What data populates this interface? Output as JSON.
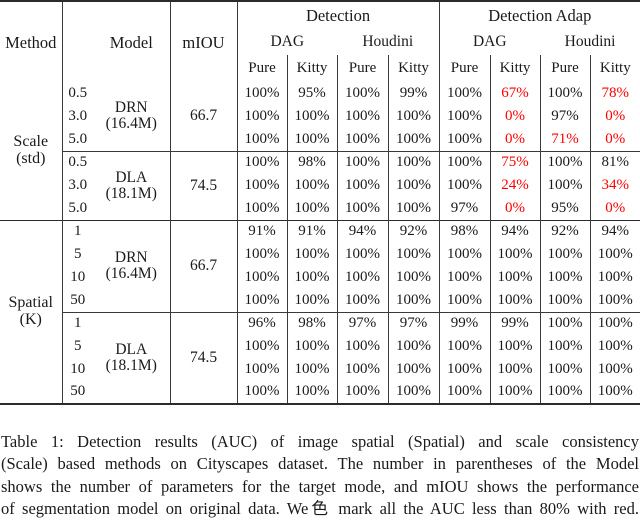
{
  "table": {
    "columns": {
      "method": "Method",
      "param": "",
      "model": "Model",
      "miou": "mIOU",
      "group_detection": "Detection",
      "group_detection_adap": "Detection Adap",
      "attack_dag_1": "DAG",
      "attack_houdini_1": "Houdini",
      "attack_dag_2": "DAG",
      "attack_houdini_2": "Houdini",
      "sub_pure": "Pure",
      "sub_kitty": "Kitty"
    },
    "sections": [
      {
        "name": "Scale",
        "name_line1": "Scale",
        "name_line2": "(std)",
        "blocks": [
          {
            "model_line1": "DRN",
            "model_line2": "(16.4M)",
            "miou": "66.7",
            "rows": [
              {
                "param": "0.5",
                "cells": [
                  {
                    "v": "100%",
                    "red": false
                  },
                  {
                    "v": "95%",
                    "red": false
                  },
                  {
                    "v": "100%",
                    "red": false
                  },
                  {
                    "v": "99%",
                    "red": false
                  },
                  {
                    "v": "100%",
                    "red": false
                  },
                  {
                    "v": "67%",
                    "red": true
                  },
                  {
                    "v": "100%",
                    "red": false
                  },
                  {
                    "v": "78%",
                    "red": true
                  }
                ]
              },
              {
                "param": "3.0",
                "cells": [
                  {
                    "v": "100%",
                    "red": false
                  },
                  {
                    "v": "100%",
                    "red": false
                  },
                  {
                    "v": "100%",
                    "red": false
                  },
                  {
                    "v": "100%",
                    "red": false
                  },
                  {
                    "v": "100%",
                    "red": false
                  },
                  {
                    "v": "0%",
                    "red": true
                  },
                  {
                    "v": "97%",
                    "red": false
                  },
                  {
                    "v": "0%",
                    "red": true
                  }
                ]
              },
              {
                "param": "5.0",
                "cells": [
                  {
                    "v": "100%",
                    "red": false
                  },
                  {
                    "v": "100%",
                    "red": false
                  },
                  {
                    "v": "100%",
                    "red": false
                  },
                  {
                    "v": "100%",
                    "red": false
                  },
                  {
                    "v": "100%",
                    "red": false
                  },
                  {
                    "v": "0%",
                    "red": true
                  },
                  {
                    "v": "71%",
                    "red": true
                  },
                  {
                    "v": "0%",
                    "red": true
                  }
                ]
              }
            ]
          },
          {
            "model_line1": "DLA",
            "model_line2": "(18.1M)",
            "miou": "74.5",
            "rows": [
              {
                "param": "0.5",
                "cells": [
                  {
                    "v": "100%",
                    "red": false
                  },
                  {
                    "v": "98%",
                    "red": false
                  },
                  {
                    "v": "100%",
                    "red": false
                  },
                  {
                    "v": "100%",
                    "red": false
                  },
                  {
                    "v": "100%",
                    "red": false
                  },
                  {
                    "v": "75%",
                    "red": true
                  },
                  {
                    "v": "100%",
                    "red": false
                  },
                  {
                    "v": "81%",
                    "red": false
                  }
                ]
              },
              {
                "param": "3.0",
                "cells": [
                  {
                    "v": "100%",
                    "red": false
                  },
                  {
                    "v": "100%",
                    "red": false
                  },
                  {
                    "v": "100%",
                    "red": false
                  },
                  {
                    "v": "100%",
                    "red": false
                  },
                  {
                    "v": "100%",
                    "red": false
                  },
                  {
                    "v": "24%",
                    "red": true
                  },
                  {
                    "v": "100%",
                    "red": false
                  },
                  {
                    "v": "34%",
                    "red": true
                  }
                ]
              },
              {
                "param": "5.0",
                "cells": [
                  {
                    "v": "100%",
                    "red": false
                  },
                  {
                    "v": "100%",
                    "red": false
                  },
                  {
                    "v": "100%",
                    "red": false
                  },
                  {
                    "v": "100%",
                    "red": false
                  },
                  {
                    "v": "97%",
                    "red": false
                  },
                  {
                    "v": "0%",
                    "red": true
                  },
                  {
                    "v": "95%",
                    "red": false
                  },
                  {
                    "v": "0%",
                    "red": true
                  }
                ]
              }
            ]
          }
        ]
      },
      {
        "name": "Spatial",
        "name_line1": "Spatial",
        "name_line2": "(K)",
        "blocks": [
          {
            "model_line1": "DRN",
            "model_line2": "(16.4M)",
            "miou": "66.7",
            "rows": [
              {
                "param": "1",
                "cells": [
                  {
                    "v": "91%",
                    "red": false
                  },
                  {
                    "v": "91%",
                    "red": false
                  },
                  {
                    "v": "94%",
                    "red": false
                  },
                  {
                    "v": "92%",
                    "red": false
                  },
                  {
                    "v": "98%",
                    "red": false
                  },
                  {
                    "v": "94%",
                    "red": false
                  },
                  {
                    "v": "92%",
                    "red": false
                  },
                  {
                    "v": "94%",
                    "red": false
                  }
                ]
              },
              {
                "param": "5",
                "cells": [
                  {
                    "v": "100%",
                    "red": false
                  },
                  {
                    "v": "100%",
                    "red": false
                  },
                  {
                    "v": "100%",
                    "red": false
                  },
                  {
                    "v": "100%",
                    "red": false
                  },
                  {
                    "v": "100%",
                    "red": false
                  },
                  {
                    "v": "100%",
                    "red": false
                  },
                  {
                    "v": "100%",
                    "red": false
                  },
                  {
                    "v": "100%",
                    "red": false
                  }
                ]
              },
              {
                "param": "10",
                "cells": [
                  {
                    "v": "100%",
                    "red": false
                  },
                  {
                    "v": "100%",
                    "red": false
                  },
                  {
                    "v": "100%",
                    "red": false
                  },
                  {
                    "v": "100%",
                    "red": false
                  },
                  {
                    "v": "100%",
                    "red": false
                  },
                  {
                    "v": "100%",
                    "red": false
                  },
                  {
                    "v": "100%",
                    "red": false
                  },
                  {
                    "v": "100%",
                    "red": false
                  }
                ]
              },
              {
                "param": "50",
                "cells": [
                  {
                    "v": "100%",
                    "red": false
                  },
                  {
                    "v": "100%",
                    "red": false
                  },
                  {
                    "v": "100%",
                    "red": false
                  },
                  {
                    "v": "100%",
                    "red": false
                  },
                  {
                    "v": "100%",
                    "red": false
                  },
                  {
                    "v": "100%",
                    "red": false
                  },
                  {
                    "v": "100%",
                    "red": false
                  },
                  {
                    "v": "100%",
                    "red": false
                  }
                ]
              }
            ]
          },
          {
            "model_line1": "DLA",
            "model_line2": "(18.1M)",
            "miou": "74.5",
            "rows": [
              {
                "param": "1",
                "cells": [
                  {
                    "v": "96%",
                    "red": false
                  },
                  {
                    "v": "98%",
                    "red": false
                  },
                  {
                    "v": "97%",
                    "red": false
                  },
                  {
                    "v": "97%",
                    "red": false
                  },
                  {
                    "v": "99%",
                    "red": false
                  },
                  {
                    "v": "99%",
                    "red": false
                  },
                  {
                    "v": "100%",
                    "red": false
                  },
                  {
                    "v": "100%",
                    "red": false
                  }
                ]
              },
              {
                "param": "5",
                "cells": [
                  {
                    "v": "100%",
                    "red": false
                  },
                  {
                    "v": "100%",
                    "red": false
                  },
                  {
                    "v": "100%",
                    "red": false
                  },
                  {
                    "v": "100%",
                    "red": false
                  },
                  {
                    "v": "100%",
                    "red": false
                  },
                  {
                    "v": "100%",
                    "red": false
                  },
                  {
                    "v": "100%",
                    "red": false
                  },
                  {
                    "v": "100%",
                    "red": false
                  }
                ]
              },
              {
                "param": "10",
                "cells": [
                  {
                    "v": "100%",
                    "red": false
                  },
                  {
                    "v": "100%",
                    "red": false
                  },
                  {
                    "v": "100%",
                    "red": false
                  },
                  {
                    "v": "100%",
                    "red": false
                  },
                  {
                    "v": "100%",
                    "red": false
                  },
                  {
                    "v": "100%",
                    "red": false
                  },
                  {
                    "v": "100%",
                    "red": false
                  },
                  {
                    "v": "100%",
                    "red": false
                  }
                ]
              },
              {
                "param": "50",
                "cells": [
                  {
                    "v": "100%",
                    "red": false
                  },
                  {
                    "v": "100%",
                    "red": false
                  },
                  {
                    "v": "100%",
                    "red": false
                  },
                  {
                    "v": "100%",
                    "red": false
                  },
                  {
                    "v": "100%",
                    "red": false
                  },
                  {
                    "v": "100%",
                    "red": false
                  },
                  {
                    "v": "100%",
                    "red": false
                  },
                  {
                    "v": "100%",
                    "red": false
                  }
                ]
              }
            ]
          }
        ]
      }
    ]
  },
  "caption": {
    "label": "Table 1:",
    "line1": "Table 1: Detection results (AUC) of image spatial (Spatial) and scale consistency",
    "line2": "(Scale) based methods on Cityscapes dataset. The number in parentheses of the Model",
    "line3": "shows the number of parameters for the target mode, and mIOU shows the performance",
    "line4": "of segmentation model on original data. We色 mark all the AUC less than 80% with red."
  },
  "colors": {
    "highlight_red": "#ff0000",
    "rule": "#2b2b2b",
    "text": "#1a1a1a"
  }
}
